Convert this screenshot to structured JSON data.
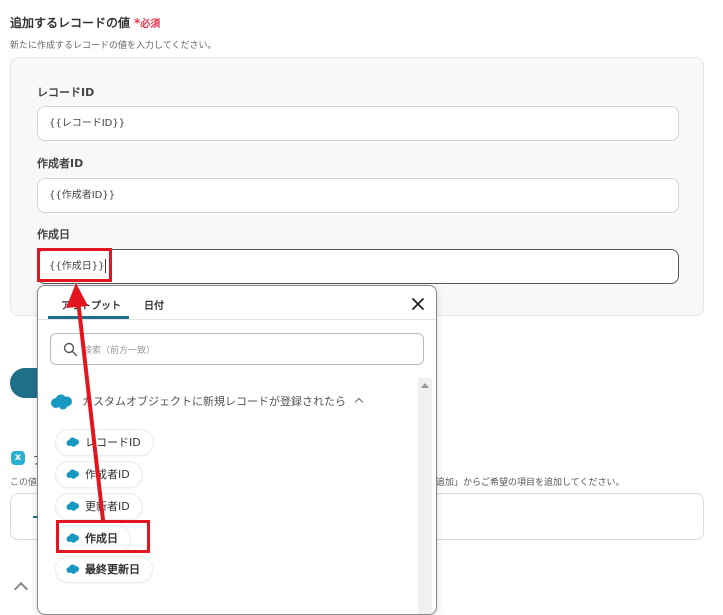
{
  "section": {
    "title": "追加するレコードの値",
    "required_star": "*",
    "required_label": "必須",
    "description": "新たに作成するレコードの値を入力してください。"
  },
  "fields": [
    {
      "label": "レコードID",
      "value": "{{レコードID}}"
    },
    {
      "label": "作成者ID",
      "value": "{{作成者ID}}"
    },
    {
      "label": "作成日",
      "value": "{{作成日}}"
    }
  ],
  "background": {
    "text1": "ア",
    "text2": "この値",
    "text3": "追加」からご希望の項目を追加してください。"
  },
  "popup": {
    "tabs": [
      {
        "label": "アウトプット",
        "active": true
      },
      {
        "label": "日付",
        "active": false
      }
    ],
    "search_placeholder": "検索（前方一致）",
    "group_header": "カスタムオブジェクトに新規レコードが登録されたら",
    "items": [
      {
        "label": "レコードID"
      },
      {
        "label": "作成者ID"
      },
      {
        "label": "更新者ID"
      },
      {
        "label": "作成日",
        "highlighted": true
      },
      {
        "label": "最終更新日"
      }
    ]
  },
  "colors": {
    "accent_teal": "#1f6f89",
    "annotation_red": "#e3151e",
    "required_red": "#e53950",
    "salesforce_blue": "#1798c1"
  },
  "icons": [
    "salesforce-cloud-icon",
    "search-icon",
    "close-icon",
    "chevron-up-icon"
  ]
}
